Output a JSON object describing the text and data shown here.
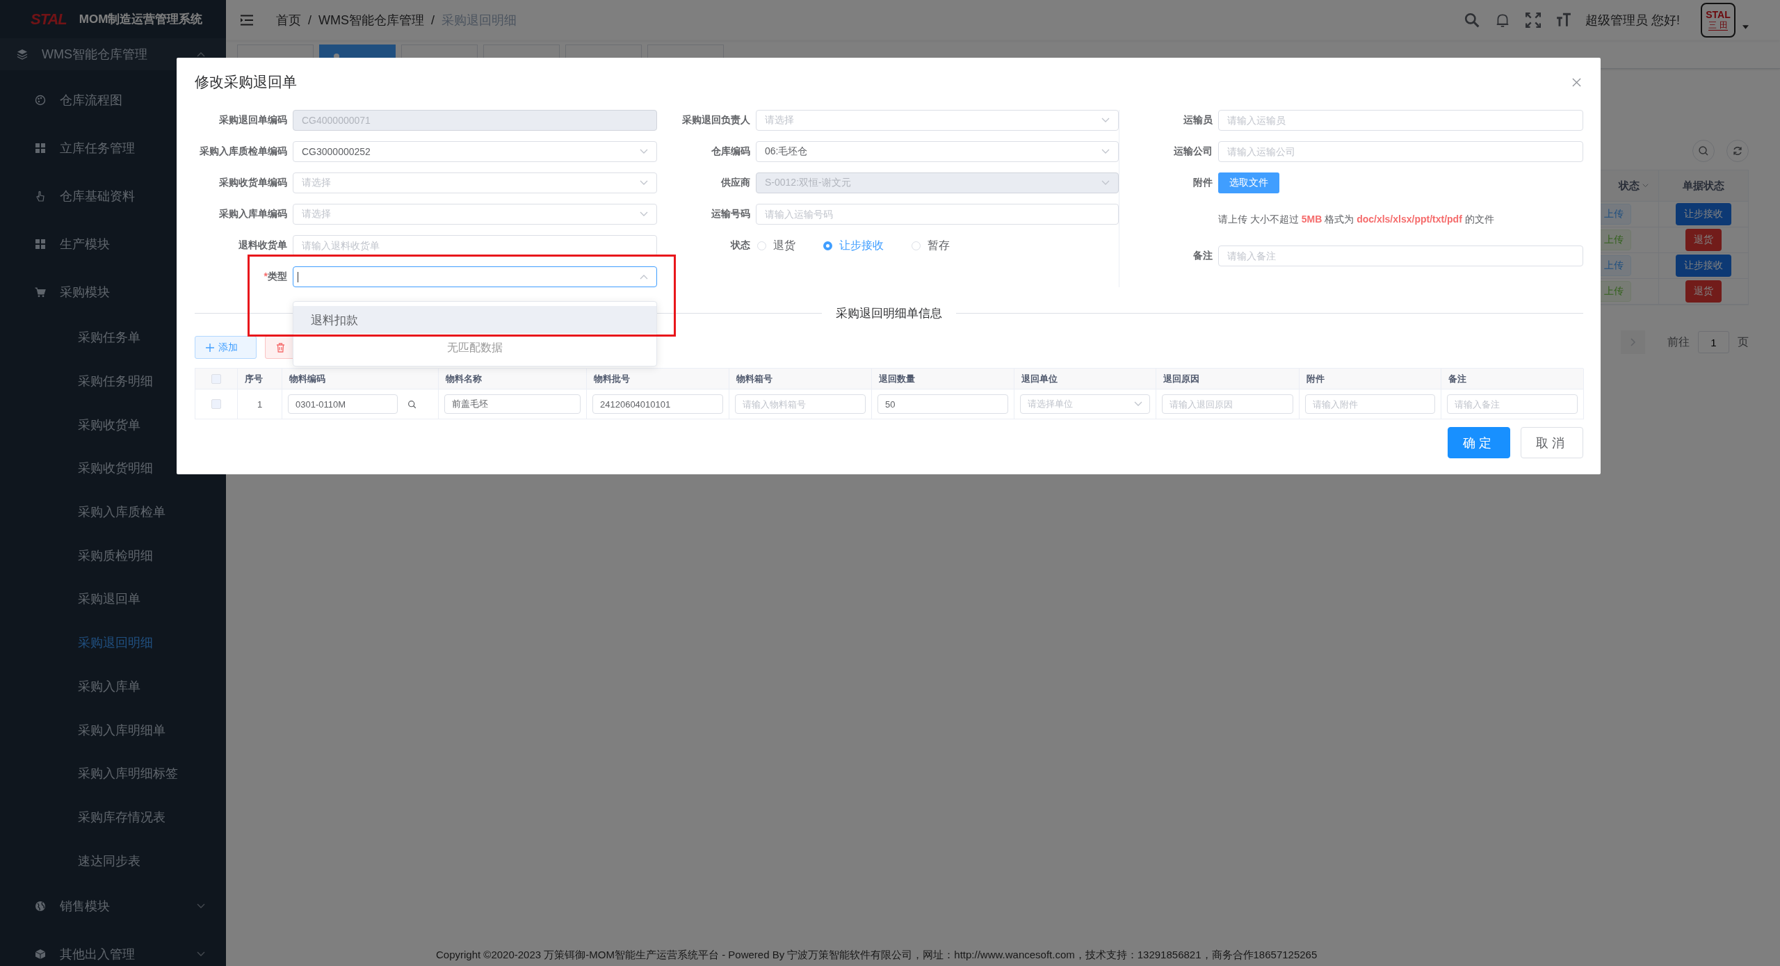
{
  "sidebar": {
    "logo": "STAL",
    "title": "MOM制造运营管理系统",
    "menu": [
      {
        "label": "WMS智能仓库管理",
        "expanded": true,
        "children": [
          {
            "label": "仓库流程图",
            "selected": false
          },
          {
            "label": "立库任务管理",
            "selected": false
          },
          {
            "label": "仓库基础资料",
            "selected": false
          },
          {
            "label": "生产模块",
            "selected": false
          },
          {
            "label": "采购模块",
            "children": [
              {
                "label": "采购任务单",
                "selected": false
              },
              {
                "label": "采购任务明细",
                "selected": false
              },
              {
                "label": "采购收货单",
                "selected": false
              },
              {
                "label": "采购收货明细",
                "selected": false
              },
              {
                "label": "采购入库质检单",
                "selected": false
              },
              {
                "label": "采购质检明细",
                "selected": false
              },
              {
                "label": "采购退回单",
                "selected": false
              },
              {
                "label": "采购退回明细",
                "selected": true
              },
              {
                "label": "采购入库单",
                "selected": false
              },
              {
                "label": "采购入库明细单",
                "selected": false
              },
              {
                "label": "采购入库明细标签",
                "selected": false
              },
              {
                "label": "采购库存情况表",
                "selected": false
              },
              {
                "label": "速达同步表",
                "selected": false
              }
            ]
          },
          {
            "label": "销售模块",
            "expanded": false
          },
          {
            "label": "其他出入管理",
            "expanded": false
          }
        ]
      }
    ]
  },
  "header": {
    "breadcrumb": [
      "首页",
      "WMS智能仓库管理",
      "采购退回明细"
    ],
    "separator": "/",
    "greeting": "超级管理员 您好!",
    "avatar": {
      "logo": "STAL",
      "subtitle": "三 田"
    }
  },
  "tabs": [
    {
      "selected": false
    },
    {
      "selected": true
    },
    {
      "selected": false
    },
    {
      "selected": false
    },
    {
      "selected": false
    },
    {
      "selected": false
    }
  ],
  "background_table": {
    "columns": [
      "状态",
      "单据状态"
    ],
    "rows": [
      {
        "upload": "上传",
        "uploaded": false,
        "status": "让步接收",
        "kind": "concession"
      },
      {
        "upload": "上传",
        "uploaded": true,
        "status": "退货",
        "kind": "return"
      },
      {
        "upload": "上传",
        "uploaded": false,
        "status": "让步接收",
        "kind": "concession"
      },
      {
        "upload": "上传",
        "uploaded": true,
        "status": "退货",
        "kind": "return"
      }
    ]
  },
  "pagination": {
    "goto": "前往",
    "page": "1",
    "suffix": "页"
  },
  "modal": {
    "title": "修改采购退回单",
    "form": {
      "required_mark": "*",
      "columns": [
        {
          "fields": [
            {
              "label": "采购退回单编码",
              "kind": "text",
              "value": "CG4000000071",
              "disabled": true,
              "required": false
            },
            {
              "label": "采购入库质检单编码",
              "kind": "select",
              "value": "CG3000000252",
              "disabled": false,
              "required": false
            },
            {
              "label": "采购收货单编码",
              "kind": "select",
              "placeholder": "请选择",
              "disabled": false,
              "required": false
            },
            {
              "label": "采购入库单编码",
              "kind": "select",
              "placeholder": "请选择",
              "disabled": false,
              "required": false
            },
            {
              "label": "退料收货单",
              "kind": "text",
              "placeholder": "请输入退料收货单",
              "disabled": false,
              "required": false
            },
            {
              "label": "类型",
              "kind": "select",
              "disabled": false,
              "required": true,
              "expanded": true,
              "options": [
                {
                  "label": "退料扣款",
                  "highlighted": true
                }
              ],
              "empty_text": "无匹配数据"
            }
          ]
        },
        {
          "fields": [
            {
              "label": "采购退回负责人",
              "kind": "select",
              "placeholder": "请选择",
              "disabled": false,
              "required": false
            },
            {
              "label": "仓库编码",
              "kind": "select",
              "value": "06:毛坯仓",
              "disabled": false,
              "required": false
            },
            {
              "label": "供应商",
              "kind": "select",
              "value": "S-0012:双恒-谢文元",
              "disabled": true,
              "required": false
            },
            {
              "label": "运输号码",
              "kind": "text",
              "placeholder": "请输入运输号码",
              "disabled": false,
              "required": false
            },
            {
              "label": "状态",
              "kind": "radio",
              "required": false,
              "options": [
                {
                  "label": "退货",
                  "selected": false
                },
                {
                  "label": "让步接收",
                  "selected": true
                },
                {
                  "label": "暂存",
                  "selected": false
                }
              ]
            }
          ]
        },
        {
          "fields": [
            {
              "label": "运输员",
              "kind": "text",
              "placeholder": "请输入运输员",
              "disabled": false,
              "required": false
            },
            {
              "label": "运输公司",
              "kind": "text",
              "placeholder": "请输入运输公司",
              "disabled": false,
              "required": false
            },
            {
              "label": "附件",
              "kind": "upload",
              "button": "选取文件",
              "required": false
            },
            {
              "kind": "hint",
              "text": "请上传 大小不超过 **5MB** 格式为 **doc/xls/xlsx/ppt/txt/pdf** 的文件"
            },
            {
              "label": "备注",
              "kind": "text",
              "placeholder": "请输入备注",
              "disabled": false,
              "required": false
            }
          ]
        }
      ]
    },
    "section_title": "采购退回明细单信息",
    "toolbar": [
      {
        "kind": "add",
        "label": "添加"
      },
      {
        "kind": "delete"
      }
    ],
    "table": {
      "columns": [
        {
          "kind": "checkbox",
          "checked": false
        },
        {
          "kind": "text",
          "label": "序号"
        },
        {
          "kind": "text",
          "label": "物料编码"
        },
        {
          "kind": "text",
          "label": "物料名称"
        },
        {
          "kind": "text",
          "label": "物料批号"
        },
        {
          "kind": "text",
          "label": "物料箱号"
        },
        {
          "kind": "text",
          "label": "退回数量"
        },
        {
          "kind": "text",
          "label": "退回单位"
        },
        {
          "kind": "text",
          "label": "退回原因"
        },
        {
          "kind": "text",
          "label": "附件"
        },
        {
          "kind": "text",
          "label": "备注"
        }
      ],
      "rows": [
        {
          "cells": [
            {
              "kind": "checkbox",
              "checked": false
            },
            {
              "kind": "text",
              "value": "1"
            },
            {
              "kind": "search",
              "value": "0301-0110M"
            },
            {
              "kind": "input",
              "value": "前盖毛坯"
            },
            {
              "kind": "input",
              "value": "24120604010101"
            },
            {
              "kind": "input",
              "placeholder": "请输入物料箱号"
            },
            {
              "kind": "input",
              "value": "50"
            },
            {
              "kind": "select",
              "placeholder": "请选择单位"
            },
            {
              "kind": "input",
              "placeholder": "请输入退回原因"
            },
            {
              "kind": "input",
              "placeholder": "请输入附件"
            },
            {
              "kind": "input",
              "placeholder": "请输入备注"
            }
          ]
        }
      ]
    },
    "buttons": [
      {
        "kind": "primary",
        "label": "确定"
      },
      {
        "kind": "default",
        "label": "取消"
      }
    ]
  },
  "footer": "Copyright ©2020-2023 万策铒御-MOM智能生产运营系统平台 - Powered By 宁波万策智能软件有限公司，网址：http://www.wancesoft.com，技术支持：13291856821，商务合作18657125265"
}
